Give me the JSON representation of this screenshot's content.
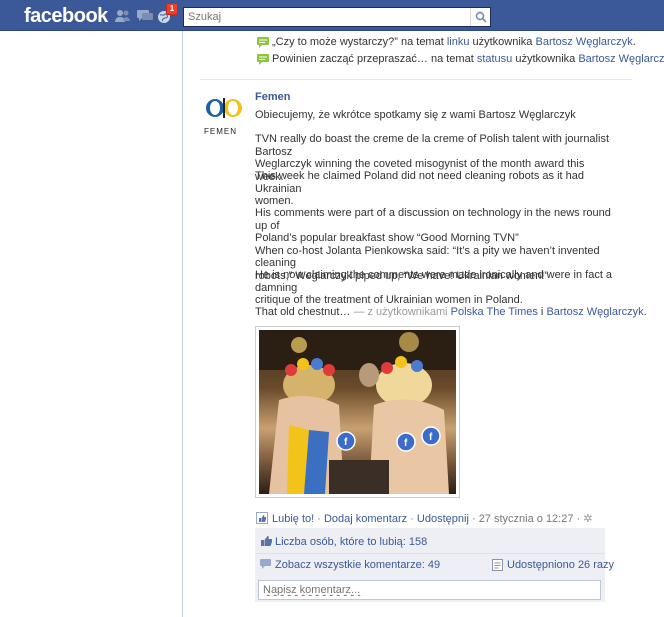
{
  "topbar": {
    "logo": "facebook",
    "notification_count": "1",
    "search_placeholder": "Szukaj"
  },
  "activity": [
    {
      "pre": "„Czy to może wystarczy?” na temat ",
      "link1": "linku",
      "mid": " użytkownika ",
      "link2": "Bartosz Węglarczyk",
      "post": "."
    },
    {
      "pre": "Powinien zacząć przepraszać… na temat ",
      "link1": "statusu",
      "mid": " użytkownika ",
      "link2": "Bartosz Węglarczyk",
      "post": "."
    }
  ],
  "post": {
    "author": "Femen",
    "avatar_caption": "FEMEN",
    "intro": "Obiecujemy, że wkrótce spotkamy się z wami Bartosz Węglarczyk",
    "p1a": "TVN really do boast the creme de la creme of Polish talent with journalist Bartosz",
    "p1b": "Weglarczyk winning the coveted misogynist of the month award this week.",
    "p2a": "This week he claimed Poland did not need cleaning robots as it had Ukrainian",
    "p2b": "women.",
    "p3a": "His comments were part of a discussion on technology in the news round up of",
    "p3b": "Poland’s popular breakfast show “Good Morning TVN”",
    "p3c": "When co-host Jolanta Pienkowska said: “It’s a pity we haven’t invented cleaning",
    "p3d": "robots,” Weglarczyk piped up, “We have! Ukrainian women!”",
    "p4a": "He is now claiming the comments were made ironically and were in fact a damning",
    "p4b": "critique of the treatment of Ukrainian women in Poland.",
    "tail_text": "That old chestnut…",
    "tail_with": " — z użytkownikami ",
    "tail_link1": "Polska The Times",
    "tail_and": " i ",
    "tail_link2": "Bartosz Węglarczyk",
    "tail_end": "."
  },
  "actions": {
    "like": "Lubię to!",
    "dot1": " · ",
    "comment": "Dodaj komentarz",
    "dot2": " · ",
    "share": "Udostępnij",
    "dot3": " · ",
    "timestamp": "27 stycznia o 12:27",
    "dot4": " · "
  },
  "ufi": {
    "likes": "Liczba osób, które to lubią: 158",
    "view_all": "Zobacz wszystkie komentarze: 49",
    "shared": "Udostępniono 26 razy",
    "comment_placeholder": "Napisz komentarz..."
  },
  "colors": {
    "topbar": "#3b5998",
    "link": "#3b5998",
    "ufi_bg": "#edeff4",
    "badge": "#f03d25"
  }
}
